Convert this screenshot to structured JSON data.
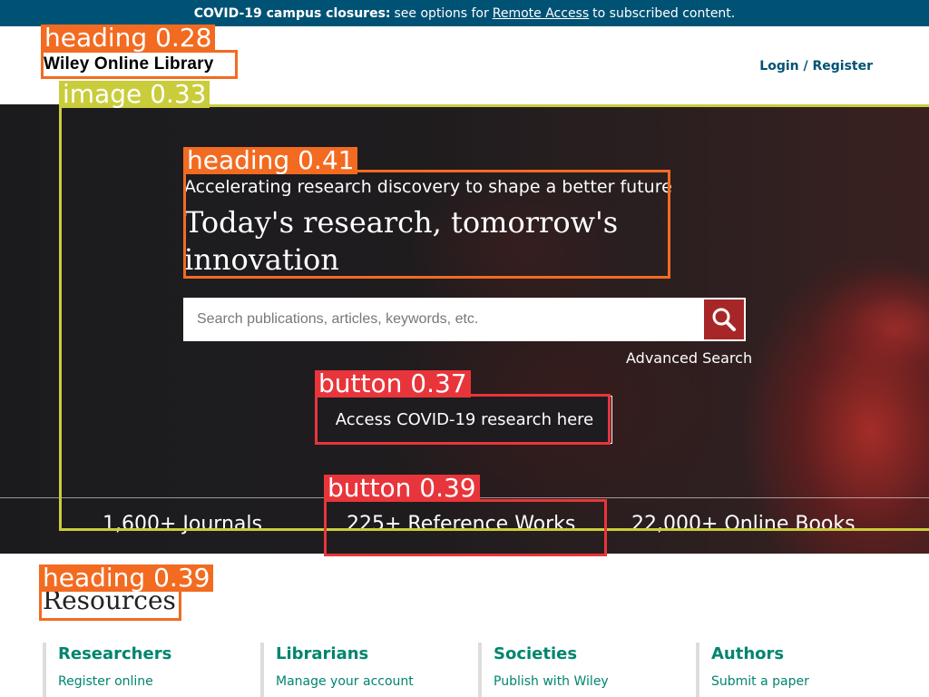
{
  "banner": {
    "bold_text": "COVID-19 campus closures:",
    "text_before_link": "see options for",
    "link_text": "Remote Access",
    "text_after_link": "to subscribed content."
  },
  "header": {
    "logo": "Wiley Online Library",
    "login": "Login / Register"
  },
  "hero": {
    "tagline": "Accelerating research discovery to shape a better future",
    "title": "Today's research, tomorrow's innovation",
    "search_placeholder": "Search publications, articles, keywords, etc.",
    "search_icon": "search-icon",
    "advanced_search": "Advanced Search",
    "covid_button": "Access COVID-19 research here",
    "stats": [
      "1,600+ Journals",
      "225+ Reference Works",
      "22,000+ Online Books"
    ]
  },
  "resources": {
    "title": "Resources",
    "columns": [
      {
        "heading": "Researchers",
        "link": "Register online"
      },
      {
        "heading": "Librarians",
        "link": "Manage your account"
      },
      {
        "heading": "Societies",
        "link": "Publish with Wiley"
      },
      {
        "heading": "Authors",
        "link": "Submit a paper"
      }
    ]
  },
  "annotations": [
    {
      "label": "heading 0.28",
      "color": "#f26b21"
    },
    {
      "label": "image 0.33",
      "color": "#c9cd3b"
    },
    {
      "label": "heading 0.41",
      "color": "#f26b21"
    },
    {
      "label": "button 0.37",
      "color": "#e8353b"
    },
    {
      "label": "button 0.39",
      "color": "#e8353b"
    },
    {
      "label": "heading 0.39",
      "color": "#f26b21"
    }
  ],
  "colors": {
    "banner_bg": "#005274",
    "link_teal": "#00856f",
    "search_button": "#a72728"
  }
}
